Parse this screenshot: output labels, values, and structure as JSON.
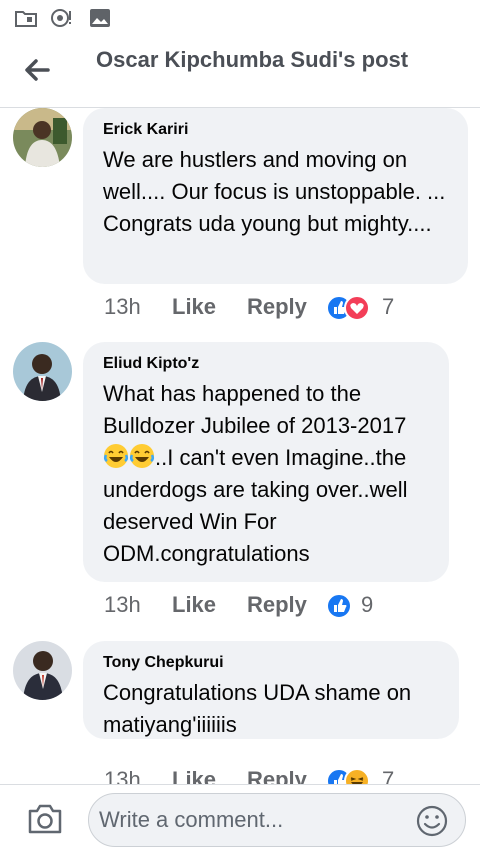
{
  "header": {
    "title": "Oscar Kipchumba Sudi's post"
  },
  "comments": [
    {
      "author": "Erick Kariri",
      "text": "We are hustlers and moving on well.... Our focus is unstoppable. ... Congrats uda young but mighty....",
      "time": "13h",
      "like_label": "Like",
      "reply_label": "Reply",
      "reactions": [
        "like-icon",
        "love-icon"
      ],
      "reaction_count": "7"
    },
    {
      "author": "Eliud Kipto'z",
      "text_parts": [
        "What has happened to the Bulldozer Jubilee of 2013-2017",
        "..I can't even Imagine..the underdogs are taking over..well deserved Win For ODM.congratulations"
      ],
      "inline_emojis": [
        "laughing-tears-emoji",
        "laughing-tears-emoji"
      ],
      "time": "13h",
      "like_label": "Like",
      "reply_label": "Reply",
      "reactions": [
        "like-icon"
      ],
      "reaction_count": "9"
    },
    {
      "author": "Tony Chepkurui",
      "text": "Congratulations UDA shame on matiyang'iiiiiis",
      "time": "13h",
      "like_label": "Like",
      "reply_label": "Reply",
      "reactions": [
        "like-icon",
        "haha-icon"
      ],
      "reaction_count": "7"
    }
  ],
  "composer": {
    "placeholder": "Write a comment..."
  },
  "colors": {
    "like_blue": "#1877f2",
    "love_red": "#f33e58",
    "haha_yellow": "#f7b125",
    "bubble_bg": "#f0f2f5",
    "title_gray": "#4b4f56"
  },
  "statusbar": {
    "icons": [
      "folder-icon",
      "media-sync-icon",
      "image-icon"
    ]
  }
}
